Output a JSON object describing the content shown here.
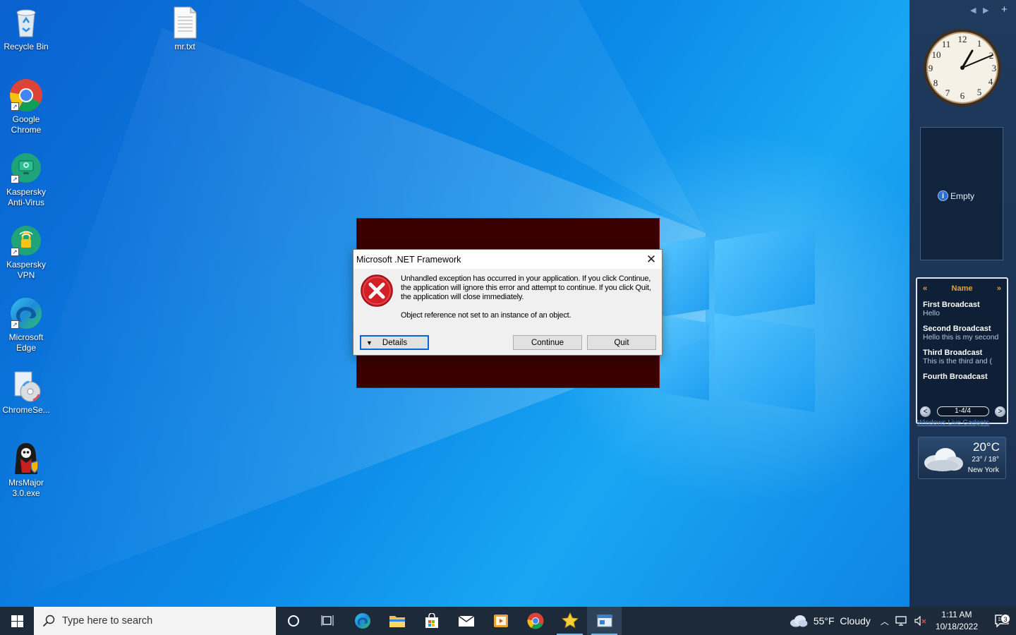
{
  "desktop": {
    "icons": [
      {
        "label": "Recycle Bin"
      },
      {
        "label": "mr.txt"
      },
      {
        "label": "Google Chrome"
      },
      {
        "label": "Kaspersky Anti-Virus"
      },
      {
        "label": "Kaspersky VPN"
      },
      {
        "label": "Microsoft Edge"
      },
      {
        "label": "ChromeSe..."
      },
      {
        "label": "MrsMajor 3.0.exe"
      }
    ]
  },
  "dialog": {
    "title": "Microsoft .NET Framework",
    "message": "Unhandled exception has occurred in your application. If you click Continue, the application will ignore this error and attempt to continue. If you click Quit, the application will close immediately.",
    "detail": "Object reference not set to an instance of an object.",
    "details_label": "Details",
    "continue_label": "Continue",
    "quit_label": "Quit"
  },
  "gadgets": {
    "slideshow": {
      "status": "Empty"
    },
    "broadcast": {
      "header": "Name",
      "items": [
        {
          "title": "First Broadcast",
          "sub": "Hello"
        },
        {
          "title": "Second Broadcast",
          "sub": "Hello this is my second"
        },
        {
          "title": "Third Broadcast",
          "sub": "This is the third and ("
        },
        {
          "title": "Fourth Broadcast",
          "sub": ""
        }
      ],
      "page": "1-4/4",
      "footer": "Windows Live Gadgets"
    },
    "weather": {
      "temp": "20°C",
      "hilo": "23° / 18°",
      "city": "New York"
    }
  },
  "taskbar": {
    "search_placeholder": "Type here to search",
    "weather": "55°F  Cloudy",
    "time": "1:11 AM",
    "date": "10/18/2022",
    "notifications": "3"
  },
  "colors": {
    "accent": "#0a64d8",
    "taskbar": "#1c2a3a",
    "error_red": "#d32027"
  }
}
